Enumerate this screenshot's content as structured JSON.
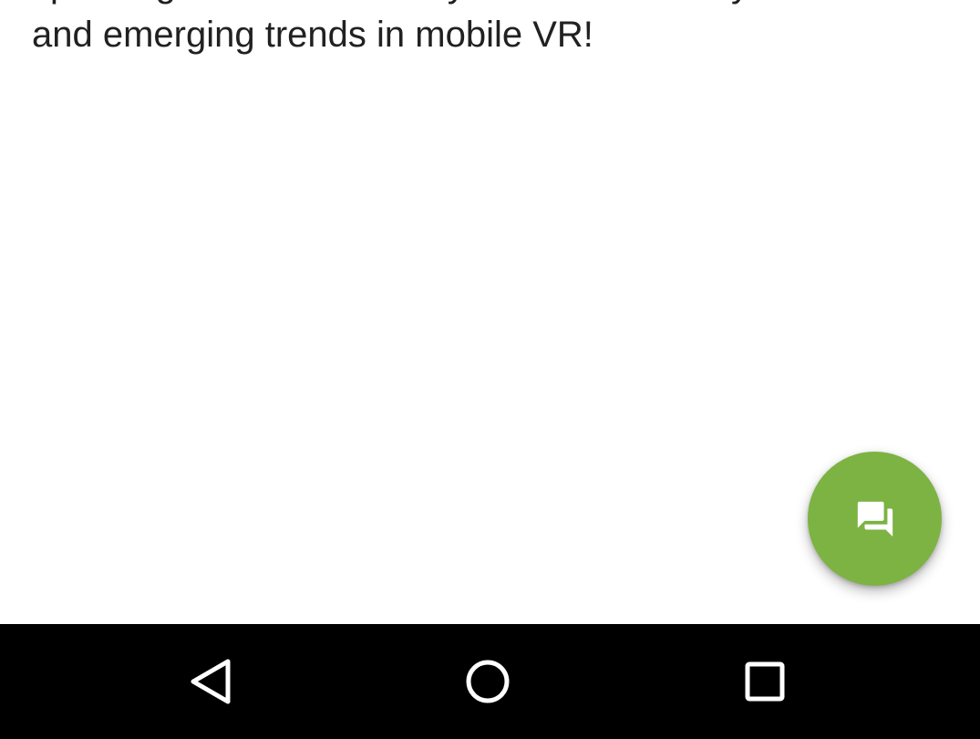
{
  "post": {
    "text_line_1": "special guest Russell Holly to talk about Daydream",
    "text_line_2": "and emerging trends in mobile VR!"
  },
  "fab": {
    "icon": "forum-icon",
    "color": "#7cb342"
  },
  "nav_bar": {
    "back_icon": "back-triangle-icon",
    "home_icon": "home-circle-icon",
    "recents_icon": "recents-square-icon",
    "background": "#000000"
  }
}
